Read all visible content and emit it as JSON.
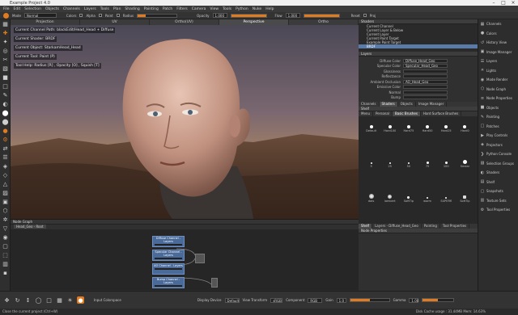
{
  "window": {
    "title": "Example Project 4.0"
  },
  "menu": [
    "File",
    "Edit",
    "Selection",
    "Objects",
    "Channels",
    "Layers",
    "Tools",
    "Plan",
    "Shading",
    "Painting",
    "Patch",
    "Filters",
    "Camera",
    "View",
    "Tools",
    "Python",
    "Nuke",
    "Help"
  ],
  "toolopts": {
    "mode_label": "Mode",
    "mode_value": "Normal",
    "colors_label": "Colors",
    "alpha_label": "Alpha",
    "paint_label": "Paint",
    "radius_label": "Radius",
    "opacity_label": "Opacity",
    "opacity_value": "1.000",
    "flow_label": "Flow",
    "flow_value": "1.000",
    "reset_label": "Reset",
    "proj_label": "Proj"
  },
  "viewport_tabs": [
    "Projection",
    "UV",
    "Ortho(UV)",
    "Perspective",
    "Ortho"
  ],
  "viewport_info": [
    "Current Channel Path: blackEdit/Head_Head + Diffuse",
    "Current Shader: BRDF",
    "Current Object: StarkamHead_Head",
    "Current Tool: Paint (P)",
    "Tool Help:  Radius [R] , Opacity [O] , Squish [T]"
  ],
  "shelf_panel": {
    "title": "Shaders"
  },
  "layers": [
    {
      "label": "Current Channel"
    },
    {
      "label": "Current Layer & Below"
    },
    {
      "label": "Current Layer"
    },
    {
      "label": "Current Paint Target"
    },
    {
      "label": "Example Paint Target"
    },
    {
      "label": "BRDF",
      "selected": true
    }
  ],
  "props_header": "Layers",
  "properties": [
    {
      "label": "Diffuse Color",
      "value": "Diffuse_Head_Geo"
    },
    {
      "label": "Specular Color",
      "value": "Specular_Head_Geo"
    },
    {
      "label": "Glossiness",
      "value": ""
    },
    {
      "label": "Reflectance",
      "value": ""
    },
    {
      "label": "Ambient Occlusion",
      "value": "AO_Head_Geo"
    },
    {
      "label": "Emissive Color",
      "value": ""
    },
    {
      "label": "Normal",
      "value": ""
    },
    {
      "label": "Bump",
      "value": ""
    }
  ],
  "mid_tabs": [
    "Channels",
    "Shaders",
    "Objects",
    "Image Manager"
  ],
  "brush_panel": {
    "title": "Shelf",
    "tabs": [
      "Menu",
      "Personal",
      "Basic Brushes",
      "Hard Surface Brushes"
    ]
  },
  "brushes": [
    {
      "label": "Default",
      "size": 4
    },
    {
      "label": "Hard100",
      "size": 4
    },
    {
      "label": "Hard75",
      "size": 4
    },
    {
      "label": "Hard50",
      "size": 4
    },
    {
      "label": "Hard25",
      "size": 4
    },
    {
      "label": "Hard0",
      "size": 4
    },
    {
      "label": "5",
      "size": 2
    },
    {
      "label": "25",
      "size": 2
    },
    {
      "label": "50",
      "size": 2
    },
    {
      "label": "75",
      "size": 3
    },
    {
      "label": "100",
      "size": 3
    },
    {
      "label": "Smear",
      "size": 5
    },
    {
      "label": "dots",
      "size": 6
    },
    {
      "label": "lambert",
      "size": 5
    },
    {
      "label": "SoftTip",
      "size": 3
    },
    {
      "label": "worm",
      "size": 2
    },
    {
      "label": "SUPERfl",
      "size": 2
    },
    {
      "label": "SoftTip",
      "size": 4
    }
  ],
  "brush_bottom_tabs": [
    "Shelf",
    "Layers - Diffuse_Head_Geo",
    "Painting",
    "Tool Properties"
  ],
  "sidebar": [
    {
      "label": "Channels",
      "icon": "▦"
    },
    {
      "label": "Colors",
      "icon": "●"
    },
    {
      "label": "History View",
      "icon": "↺"
    },
    {
      "label": "Image Manager",
      "icon": "▣"
    },
    {
      "label": "Layers",
      "icon": "☰"
    },
    {
      "label": "Lights",
      "icon": "☀"
    },
    {
      "label": "Mode Render",
      "icon": "◉"
    },
    {
      "label": "Node Graph",
      "icon": "⬡"
    },
    {
      "label": "Node Properties",
      "icon": "≡"
    },
    {
      "label": "Objects",
      "icon": "■"
    },
    {
      "label": "Painting",
      "icon": "✎"
    },
    {
      "label": "Patches",
      "icon": "□"
    },
    {
      "label": "Play Controls",
      "icon": "▶"
    },
    {
      "label": "Projectors",
      "icon": "◈"
    },
    {
      "label": "Python Console",
      "icon": "❯"
    },
    {
      "label": "Selection Groups",
      "icon": "▨"
    },
    {
      "label": "Shaders",
      "icon": "◐"
    },
    {
      "label": "Shelf",
      "icon": "▤"
    },
    {
      "label": "Snapshots",
      "icon": "▢"
    },
    {
      "label": "Texture Sets",
      "icon": "▥"
    },
    {
      "label": "Tool Properties",
      "icon": "⚙"
    }
  ],
  "nodegraph": {
    "title": "Node Graph",
    "tab": "Head_Geo - Root",
    "props_title": "Node Properties",
    "nodes": [
      "Diffuse Channel - Layers",
      "Specular Channel - Layers",
      "AO Channel - Layers",
      "Bump Channel - Layers"
    ]
  },
  "bottom": {
    "colorspace_label": "Input Colorspace",
    "display_label": "Display Device",
    "display_value": "Default",
    "view_label": "View Transform",
    "view_value": "sRGB",
    "component_label": "Component",
    "component_value": "RGB",
    "gain_label": "Gain",
    "gain_value": "1.0",
    "gamma_label": "Gamma",
    "gamma_value": "1.00"
  },
  "status": {
    "left": "Close the current project  (Ctrl+W)",
    "right": "Disk Cache usage : 31.44MB   Mem: 14.63%"
  }
}
